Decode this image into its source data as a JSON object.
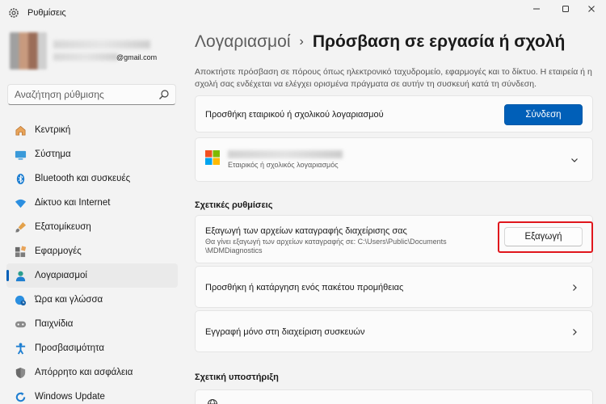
{
  "window": {
    "title": "Ρυθμίσεις",
    "controls": [
      "minimize-icon",
      "maximize-icon",
      "close-icon"
    ]
  },
  "profile": {
    "email_suffix": "@gmail.com"
  },
  "search": {
    "placeholder": "Αναζήτηση ρύθμισης",
    "icon": "search-icon"
  },
  "sidebar": {
    "items": [
      {
        "label": "Κεντρική",
        "icon": "home-icon"
      },
      {
        "label": "Σύστημα",
        "icon": "system-icon"
      },
      {
        "label": "Bluetooth και συσκευές",
        "icon": "bluetooth-icon"
      },
      {
        "label": "Δίκτυο και Internet",
        "icon": "wifi-icon"
      },
      {
        "label": "Εξατομίκευση",
        "icon": "brush-icon"
      },
      {
        "label": "Εφαρμογές",
        "icon": "apps-icon"
      },
      {
        "label": "Λογαριασμοί",
        "icon": "account-icon",
        "selected": true
      },
      {
        "label": "Ώρα και γλώσσα",
        "icon": "time-language-icon"
      },
      {
        "label": "Παιχνίδια",
        "icon": "gamepad-icon"
      },
      {
        "label": "Προσβασιμότητα",
        "icon": "accessibility-icon"
      },
      {
        "label": "Απόρρητο και ασφάλεια",
        "icon": "shield-icon"
      },
      {
        "label": "Windows Update",
        "icon": "update-icon"
      }
    ]
  },
  "breadcrumb": {
    "parent": "Λογαριασμοί",
    "separator": "›",
    "current": "Πρόσβαση σε εργασία ή σχολή"
  },
  "description": "Αποκτήστε πρόσβαση σε πόρους όπως ηλεκτρονικό ταχυδρομείο, εφαρμογές και το δίκτυο. Η εταιρεία ή η σχολή σας ενδέχεται να ελέγχει ορισμένα πράγματα σε αυτήν τη συσκευή κατά τη σύνδεση.",
  "add_account": {
    "label": "Προσθήκη εταιρικού ή σχολικού λογαριασμού",
    "button": "Σύνδεση"
  },
  "account": {
    "subtitle": "Εταιρικός ή σχολικός λογαριασμός"
  },
  "related_settings": {
    "heading": "Σχετικές ρυθμίσεις",
    "export": {
      "title": "Εξαγωγή των αρχείων καταγραφής διαχείρισης σας",
      "subtitle_line1": "Θα γίνει εξαγωγή των αρχείων καταγραφής σε: C:\\Users\\Public\\Documents",
      "subtitle_line2": "\\MDMDiagnostics",
      "button": "Εξαγωγή"
    },
    "provisioning": "Προσθήκη ή κατάργηση ενός πακέτου προμήθειας",
    "enroll": "Εγγραφή μόνο στη διαχείριση συσκευών"
  },
  "related_support": {
    "heading": "Σχετική υποστήριξη"
  },
  "colors": {
    "accent": "#005fb8",
    "highlight": "#e0161c"
  }
}
